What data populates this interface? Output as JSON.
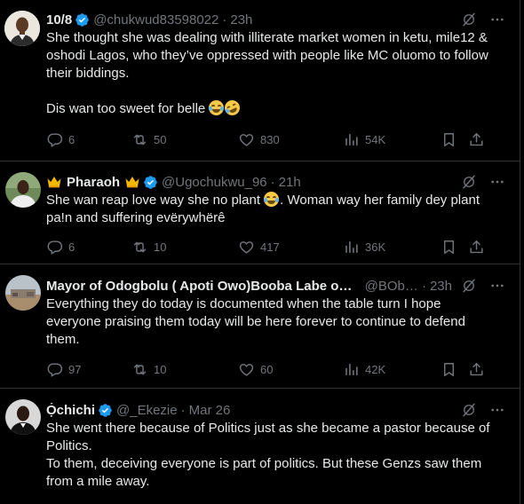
{
  "tweets": [
    {
      "name": "10/8",
      "verified": true,
      "handle": "@chukwud83598022",
      "separator": "·",
      "time": "23h",
      "text_lines": [
        "She thought she was dealing with illiterate market women in ketu, mile12 &",
        "oshodi Lagos, who they’ve oppressed with people like MC oluomo to follow",
        "their biddings.",
        "",
        "Dis wan too sweet for belle"
      ],
      "stats": {
        "replies": "6",
        "reposts": "50",
        "likes": "830",
        "views": "54K"
      }
    },
    {
      "name": "Pharaoh",
      "verified": true,
      "handle": "@Ugochukwu_96",
      "separator": "·",
      "time": "21h",
      "text_lines": [
        "She wan reap love way she no plant",
        ". Woman way her family dey plant",
        "pa!n and suffering evërywhërê"
      ],
      "stats": {
        "replies": "6",
        "reposts": "10",
        "likes": "417",
        "views": "36K"
      }
    },
    {
      "name": "Mayor of Odogbolu ( Apoti Owo)Booba Labe of ...",
      "verified": false,
      "handle": "@BObi...",
      "separator": "·",
      "time": "23h",
      "text_lines": [
        "Everything they do today is documented when the table turn I hope",
        "everyone praising them today will be here forever to continue to defend",
        "them."
      ],
      "stats": {
        "replies": "97",
        "reposts": "10",
        "likes": "60",
        "views": "42K"
      }
    },
    {
      "name": "Ọ́chichi",
      "verified": true,
      "handle": "@_Ekezie",
      "separator": "·",
      "time": "Mar 26",
      "text_lines": [
        "She went there because of Politics just as she became a pastor because of",
        "Politics.",
        "To them, deceiving everyone is part of politics. But these Genzs saw them",
        "from a mile away."
      ]
    }
  ],
  "icons": {
    "reply": "reply-icon",
    "repost": "repost-icon",
    "like": "heart-icon",
    "views": "views-icon",
    "bookmark": "bookmark-icon",
    "share": "share-icon",
    "grok": "grok-icon",
    "more": "more-icon",
    "verified": "verified-badge-icon",
    "crown": "crown-emoji-icon"
  },
  "colors": {
    "background": "#000000",
    "text": "#e7e9ea",
    "muted": "#71767b",
    "verified": "#1d9bf0",
    "divider": "#2f3336"
  }
}
